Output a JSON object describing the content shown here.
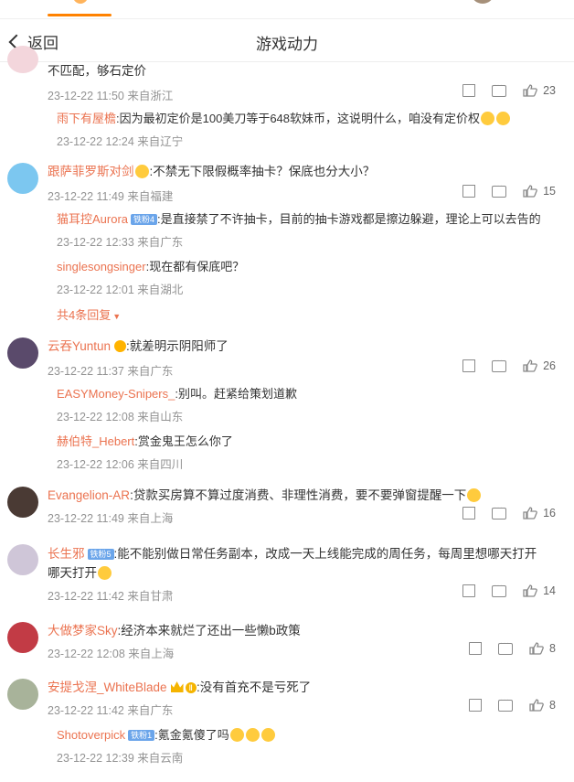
{
  "nav": {
    "back_label": "返回",
    "title": "游戏动力"
  },
  "colors": {
    "accent": "#ff8200",
    "username": "#eb7350",
    "meta": "#939393"
  },
  "comments": [
    {
      "text": "不匹配，够石定价",
      "time": "23-12-22 11:50 来自浙江",
      "likes": "23",
      "replies": [
        {
          "user": "雨下有屋檐",
          "text": ":因为最初定价是100美刀等于648软妹币，这说明什么，咱没有定价权",
          "time": "23-12-22 12:24 来自辽宁"
        }
      ]
    },
    {
      "user": "跟萨菲罗斯对剑",
      "text": ":不禁无下限假概率抽卡？保底也分大小？",
      "time": "23-12-22 11:49 来自福建",
      "likes": "15",
      "replies": [
        {
          "user": "猫耳控Aurora",
          "badge": "铁粉4",
          "text": ":是直接禁了不许抽卡，目前的抽卡游戏都是擦边躲避，理论上可以去告的",
          "time": "23-12-22 12:33 来自广东"
        },
        {
          "user": "singlesongsinger",
          "text": ":现在都有保底吧？",
          "time": "23-12-22 12:01 来自湖北"
        }
      ],
      "more": "共4条回复"
    },
    {
      "user": "云吞Yuntun",
      "text": ":就差明示阴阳师了",
      "time": "23-12-22 11:37 来自广东",
      "likes": "26",
      "replies": [
        {
          "user": "EASYMoney-Snipers_",
          "text": ":别叫。赶紧给策划道歉",
          "time": "23-12-22 12:08 来自山东"
        },
        {
          "user": "赫伯特_Hebert",
          "text": ":赏金鬼王怎么你了",
          "time": "23-12-22 12:06 来自四川"
        }
      ]
    },
    {
      "user": "Evangelion-AR",
      "text": ":贷款买房算不算过度消费、非理性消费，要不要弹窗提醒一下",
      "time": "23-12-22 11:49 来自上海",
      "likes": "16"
    },
    {
      "user": "长生邪",
      "badge": "铁粉5",
      "text": ":能不能别做日常任务副本，改成一天上线能完成的周任务，每周里想哪天打开哪天打开",
      "time": "23-12-22 11:42 来自甘肃",
      "likes": "14"
    },
    {
      "user": "大做梦家Sky",
      "text": ":经济本来就烂了还出一些懒b政策",
      "time": "23-12-22 12:08 来自上海",
      "likes": "8"
    },
    {
      "user": "安提戈涅_WhiteBlade",
      "text": ":没有首充不是亏死了",
      "time": "23-12-22 11:42 来自广东",
      "likes": "8",
      "replies": [
        {
          "user": "Shotoverpick",
          "badge": "铁粉1",
          "text": ":氪金氪傻了吗",
          "time": "23-12-22 12:39 来自云南"
        }
      ]
    }
  ]
}
